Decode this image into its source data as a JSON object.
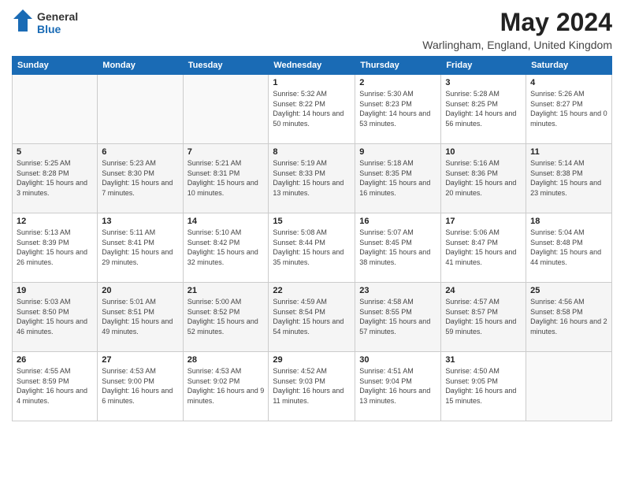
{
  "header": {
    "logo_general": "General",
    "logo_blue": "Blue",
    "month": "May 2024",
    "location": "Warlingham, England, United Kingdom"
  },
  "weekdays": [
    "Sunday",
    "Monday",
    "Tuesday",
    "Wednesday",
    "Thursday",
    "Friday",
    "Saturday"
  ],
  "weeks": [
    [
      {
        "day": "",
        "sunrise": "",
        "sunset": "",
        "daylight": ""
      },
      {
        "day": "",
        "sunrise": "",
        "sunset": "",
        "daylight": ""
      },
      {
        "day": "",
        "sunrise": "",
        "sunset": "",
        "daylight": ""
      },
      {
        "day": "1",
        "sunrise": "Sunrise: 5:32 AM",
        "sunset": "Sunset: 8:22 PM",
        "daylight": "Daylight: 14 hours and 50 minutes."
      },
      {
        "day": "2",
        "sunrise": "Sunrise: 5:30 AM",
        "sunset": "Sunset: 8:23 PM",
        "daylight": "Daylight: 14 hours and 53 minutes."
      },
      {
        "day": "3",
        "sunrise": "Sunrise: 5:28 AM",
        "sunset": "Sunset: 8:25 PM",
        "daylight": "Daylight: 14 hours and 56 minutes."
      },
      {
        "day": "4",
        "sunrise": "Sunrise: 5:26 AM",
        "sunset": "Sunset: 8:27 PM",
        "daylight": "Daylight: 15 hours and 0 minutes."
      }
    ],
    [
      {
        "day": "5",
        "sunrise": "Sunrise: 5:25 AM",
        "sunset": "Sunset: 8:28 PM",
        "daylight": "Daylight: 15 hours and 3 minutes."
      },
      {
        "day": "6",
        "sunrise": "Sunrise: 5:23 AM",
        "sunset": "Sunset: 8:30 PM",
        "daylight": "Daylight: 15 hours and 7 minutes."
      },
      {
        "day": "7",
        "sunrise": "Sunrise: 5:21 AM",
        "sunset": "Sunset: 8:31 PM",
        "daylight": "Daylight: 15 hours and 10 minutes."
      },
      {
        "day": "8",
        "sunrise": "Sunrise: 5:19 AM",
        "sunset": "Sunset: 8:33 PM",
        "daylight": "Daylight: 15 hours and 13 minutes."
      },
      {
        "day": "9",
        "sunrise": "Sunrise: 5:18 AM",
        "sunset": "Sunset: 8:35 PM",
        "daylight": "Daylight: 15 hours and 16 minutes."
      },
      {
        "day": "10",
        "sunrise": "Sunrise: 5:16 AM",
        "sunset": "Sunset: 8:36 PM",
        "daylight": "Daylight: 15 hours and 20 minutes."
      },
      {
        "day": "11",
        "sunrise": "Sunrise: 5:14 AM",
        "sunset": "Sunset: 8:38 PM",
        "daylight": "Daylight: 15 hours and 23 minutes."
      }
    ],
    [
      {
        "day": "12",
        "sunrise": "Sunrise: 5:13 AM",
        "sunset": "Sunset: 8:39 PM",
        "daylight": "Daylight: 15 hours and 26 minutes."
      },
      {
        "day": "13",
        "sunrise": "Sunrise: 5:11 AM",
        "sunset": "Sunset: 8:41 PM",
        "daylight": "Daylight: 15 hours and 29 minutes."
      },
      {
        "day": "14",
        "sunrise": "Sunrise: 5:10 AM",
        "sunset": "Sunset: 8:42 PM",
        "daylight": "Daylight: 15 hours and 32 minutes."
      },
      {
        "day": "15",
        "sunrise": "Sunrise: 5:08 AM",
        "sunset": "Sunset: 8:44 PM",
        "daylight": "Daylight: 15 hours and 35 minutes."
      },
      {
        "day": "16",
        "sunrise": "Sunrise: 5:07 AM",
        "sunset": "Sunset: 8:45 PM",
        "daylight": "Daylight: 15 hours and 38 minutes."
      },
      {
        "day": "17",
        "sunrise": "Sunrise: 5:06 AM",
        "sunset": "Sunset: 8:47 PM",
        "daylight": "Daylight: 15 hours and 41 minutes."
      },
      {
        "day": "18",
        "sunrise": "Sunrise: 5:04 AM",
        "sunset": "Sunset: 8:48 PM",
        "daylight": "Daylight: 15 hours and 44 minutes."
      }
    ],
    [
      {
        "day": "19",
        "sunrise": "Sunrise: 5:03 AM",
        "sunset": "Sunset: 8:50 PM",
        "daylight": "Daylight: 15 hours and 46 minutes."
      },
      {
        "day": "20",
        "sunrise": "Sunrise: 5:01 AM",
        "sunset": "Sunset: 8:51 PM",
        "daylight": "Daylight: 15 hours and 49 minutes."
      },
      {
        "day": "21",
        "sunrise": "Sunrise: 5:00 AM",
        "sunset": "Sunset: 8:52 PM",
        "daylight": "Daylight: 15 hours and 52 minutes."
      },
      {
        "day": "22",
        "sunrise": "Sunrise: 4:59 AM",
        "sunset": "Sunset: 8:54 PM",
        "daylight": "Daylight: 15 hours and 54 minutes."
      },
      {
        "day": "23",
        "sunrise": "Sunrise: 4:58 AM",
        "sunset": "Sunset: 8:55 PM",
        "daylight": "Daylight: 15 hours and 57 minutes."
      },
      {
        "day": "24",
        "sunrise": "Sunrise: 4:57 AM",
        "sunset": "Sunset: 8:57 PM",
        "daylight": "Daylight: 15 hours and 59 minutes."
      },
      {
        "day": "25",
        "sunrise": "Sunrise: 4:56 AM",
        "sunset": "Sunset: 8:58 PM",
        "daylight": "Daylight: 16 hours and 2 minutes."
      }
    ],
    [
      {
        "day": "26",
        "sunrise": "Sunrise: 4:55 AM",
        "sunset": "Sunset: 8:59 PM",
        "daylight": "Daylight: 16 hours and 4 minutes."
      },
      {
        "day": "27",
        "sunrise": "Sunrise: 4:53 AM",
        "sunset": "Sunset: 9:00 PM",
        "daylight": "Daylight: 16 hours and 6 minutes."
      },
      {
        "day": "28",
        "sunrise": "Sunrise: 4:53 AM",
        "sunset": "Sunset: 9:02 PM",
        "daylight": "Daylight: 16 hours and 9 minutes."
      },
      {
        "day": "29",
        "sunrise": "Sunrise: 4:52 AM",
        "sunset": "Sunset: 9:03 PM",
        "daylight": "Daylight: 16 hours and 11 minutes."
      },
      {
        "day": "30",
        "sunrise": "Sunrise: 4:51 AM",
        "sunset": "Sunset: 9:04 PM",
        "daylight": "Daylight: 16 hours and 13 minutes."
      },
      {
        "day": "31",
        "sunrise": "Sunrise: 4:50 AM",
        "sunset": "Sunset: 9:05 PM",
        "daylight": "Daylight: 16 hours and 15 minutes."
      },
      {
        "day": "",
        "sunrise": "",
        "sunset": "",
        "daylight": ""
      }
    ]
  ]
}
